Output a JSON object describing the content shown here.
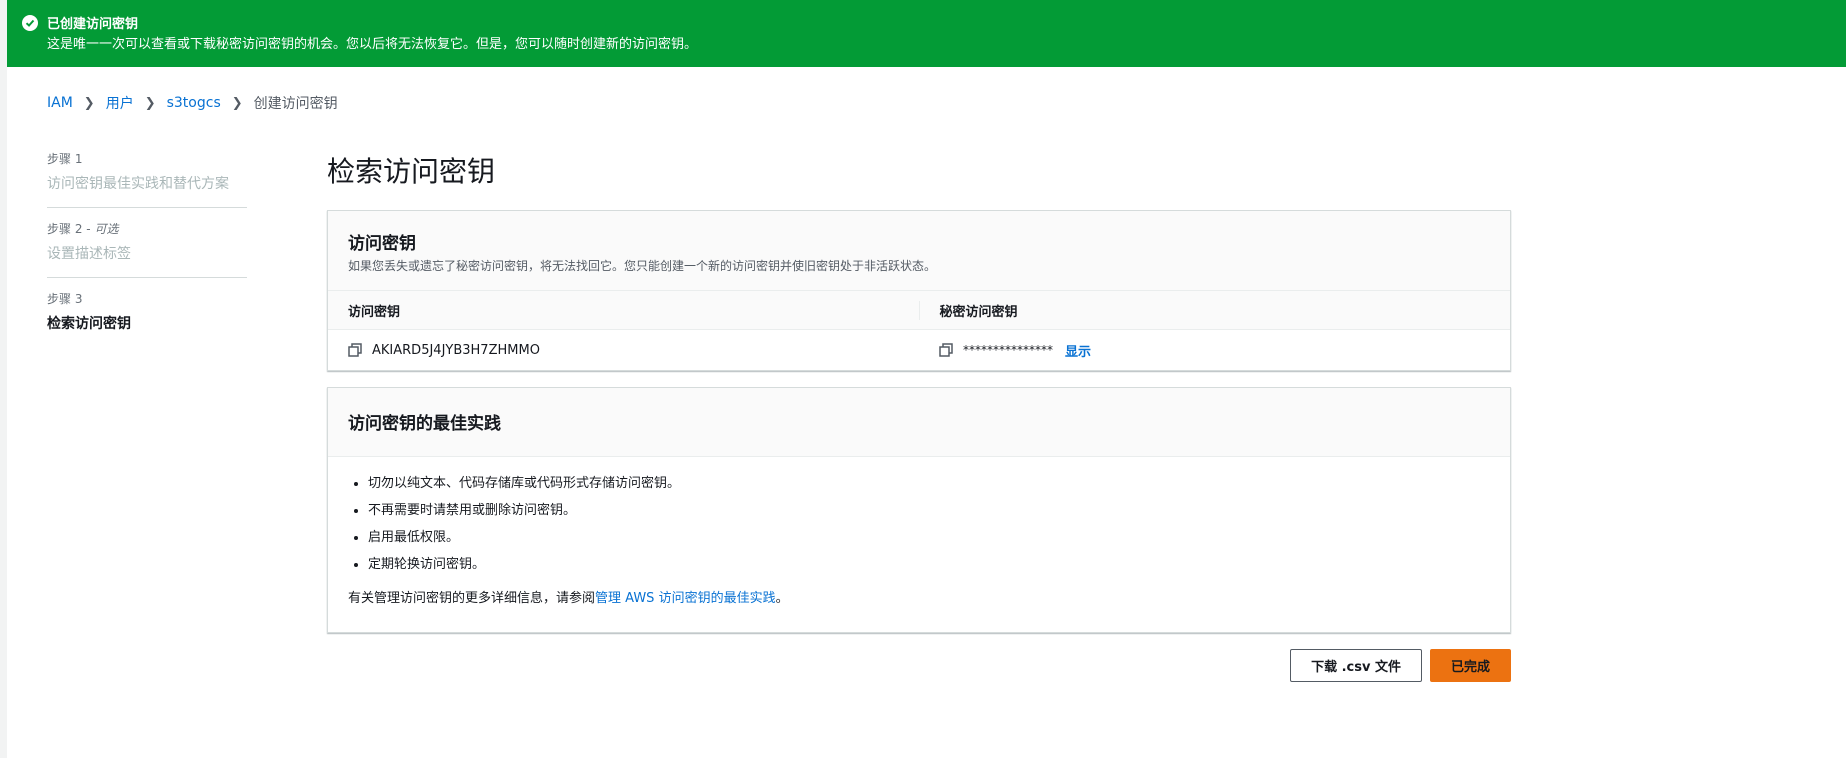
{
  "flash": {
    "title": "已创建访问密钥",
    "message": "这是唯一一次可以查看或下载秘密访问密钥的机会。您以后将无法恢复它。但是，您可以随时创建新的访问密钥。"
  },
  "breadcrumb": {
    "items": [
      "IAM",
      "用户",
      "s3togcs"
    ],
    "current": "创建访问密钥"
  },
  "steps": [
    {
      "num": "步骤 1",
      "optional": "",
      "name": "访问密钥最佳实践和替代方案"
    },
    {
      "num": "步骤 2 -",
      "optional": "可选",
      "name": "设置描述标签"
    },
    {
      "num": "步骤 3",
      "optional": "",
      "name": "检索访问密钥"
    }
  ],
  "page_title": "检索访问密钥",
  "access_key_card": {
    "title": "访问密钥",
    "description": "如果您丢失或遗忘了秘密访问密钥，将无法找回它。您只能创建一个新的访问密钥并使旧密钥处于非活跃状态。",
    "col_access_key": "访问密钥",
    "col_secret_key": "秘密访问密钥",
    "access_key_value": "AKIARD5J4JYB3H7ZHMMO",
    "secret_key_masked": "***************",
    "show_label": "显示"
  },
  "best_practices": {
    "title": "访问密钥的最佳实践",
    "items": [
      "切勿以纯文本、代码存储库或代码形式存储访问密钥。",
      "不再需要时请禁用或删除访问密钥。",
      "启用最低权限。",
      "定期轮换访问密钥。"
    ],
    "more_prefix": "有关管理访问密钥的更多详细信息，请参阅",
    "more_link": "管理 AWS 访问密钥的最佳实践",
    "more_suffix": "。"
  },
  "actions": {
    "download_label": "下载 .csv 文件",
    "done_label": "已完成"
  },
  "colors": {
    "flash_green": "#039b36",
    "link_blue": "#0972d3",
    "primary_orange": "#ec7211"
  }
}
